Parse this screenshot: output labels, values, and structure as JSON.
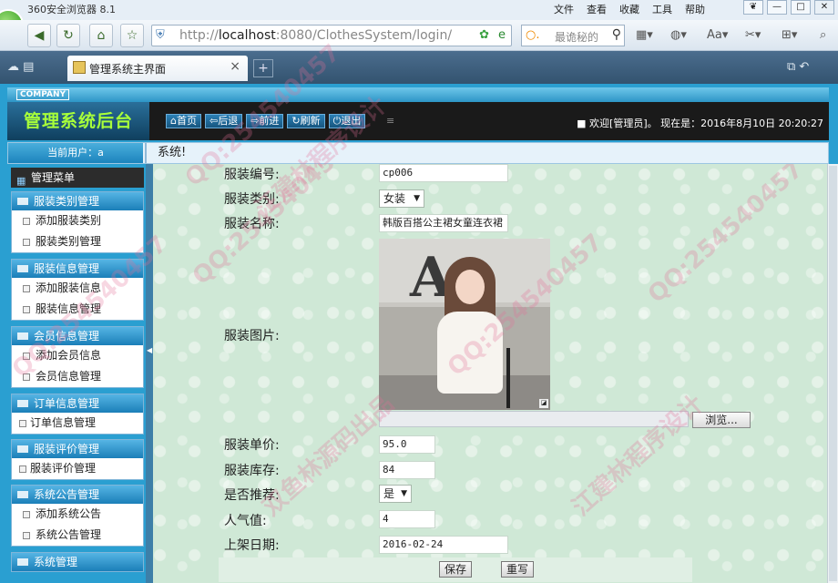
{
  "browser": {
    "app_title": "360安全浏览器 8.1",
    "menus": [
      "文件",
      "查看",
      "收藏",
      "工具",
      "帮助"
    ],
    "url_host": "localhost",
    "url_full_prefix": "http://",
    "url_rest": ":8080/ClothesSystem/login/",
    "search_placeholder": "最诡秘的",
    "tab_title": "管理系统主界面",
    "tab_close": "×",
    "new_tab": "+"
  },
  "header": {
    "company": "COMPANY",
    "system_title": "管理系统后台",
    "buttons": [
      "首页",
      "后退",
      "前进",
      "刷新",
      "退出"
    ],
    "welcome": "■ 欢迎[管理员]。 现在是：2016年8月10日 20:20:27"
  },
  "breadcrumb": {
    "current_user": "当前用户：a",
    "location": "系统!"
  },
  "sidebar": {
    "menu_title": "管理菜单",
    "groups": [
      {
        "title": "服装类别管理",
        "items": [
          "添加服装类别",
          "服装类别管理"
        ]
      },
      {
        "title": "服装信息管理",
        "items": [
          "添加服装信息",
          "服装信息管理"
        ]
      },
      {
        "title": "会员信息管理",
        "items": [
          "添加会员信息",
          "会员信息管理"
        ]
      },
      {
        "title": "订单信息管理",
        "items": [
          "订单信息管理"
        ]
      },
      {
        "title": "服装评价管理",
        "items": [
          "服装评价管理"
        ]
      },
      {
        "title": "系统公告管理",
        "items": [
          "添加系统公告",
          "系统公告管理"
        ]
      },
      {
        "title": "系统管理",
        "items": []
      }
    ]
  },
  "form": {
    "code_label": "服装编号:",
    "code_value": "cp006",
    "category_label": "服装类别:",
    "category_value": "女装",
    "name_label": "服装名称:",
    "name_value": "韩版百搭公主裙女童连衣裙",
    "image_label": "服装图片:",
    "browse_label": "浏览...",
    "price_label": "服装单价:",
    "price_value": "95.0",
    "stock_label": "服装库存:",
    "stock_value": "84",
    "recommend_label": "是否推荐:",
    "recommend_value": "是",
    "popularity_label": "人气值:",
    "popularity_value": "4",
    "date_label": "上架日期:",
    "date_value": "2016-02-24",
    "save_label": "保存",
    "reset_label": "重写"
  },
  "watermarks": [
    "QQ:254540457",
    "江建林程序设计",
    "双鱼林源码出品"
  ],
  "colors": {
    "accent": "#2a9fd1",
    "title_green": "#a8ff3a",
    "header_bg": "#1a1a1a"
  }
}
